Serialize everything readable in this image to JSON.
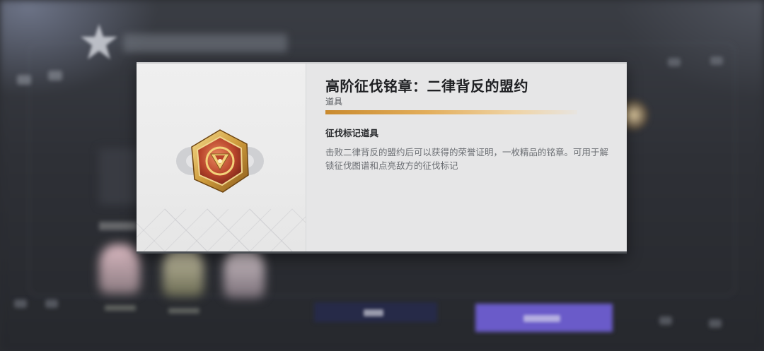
{
  "item": {
    "name": "高阶征伐铭章：二律背反的盟约",
    "category": "道具",
    "subtitle": "征伐标记道具",
    "description": "击败二律背反的盟约后可以获得的荣誉证明，一枚精品的铭章。可用于解锁征伐图谱和点亮敌方的征伐标记",
    "icon": "hexagon-medal-icon",
    "rarity_color": "#d99a3e"
  },
  "colors": {
    "card_background": "#e5e6e7",
    "medal_gold": "#d8b25a",
    "medal_red": "#b8442b",
    "action_button_purple": "#6a5bc9"
  }
}
